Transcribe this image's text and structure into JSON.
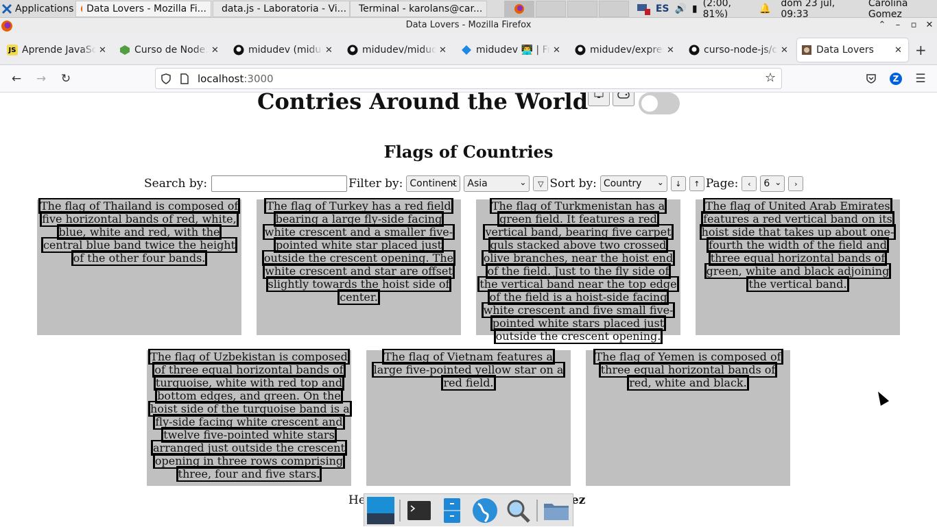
{
  "panel": {
    "applications_label": "Applications",
    "tasks": [
      {
        "label": "Data Lovers - Mozilla Fi..."
      },
      {
        "label": "data.js - Laboratoria - Vi..."
      },
      {
        "label": "Terminal - karolans@car..."
      }
    ],
    "keyboard_layout": "ES",
    "battery": "(2:00, 81%)",
    "datetime": "dom 23 jul, 09:33",
    "user": "Carolina Gomez"
  },
  "window": {
    "title": "Data Lovers - Mozilla Firefox"
  },
  "tabs": [
    {
      "label": "Aprende JavaScript"
    },
    {
      "label": "Curso de Node.js"
    },
    {
      "label": "midudev (midudev)"
    },
    {
      "label": "midudev/midudev"
    },
    {
      "label": "midudev 👨‍💻 | Fro"
    },
    {
      "label": "midudev/express"
    },
    {
      "label": "curso-node-js/cl"
    },
    {
      "label": "Data Lovers"
    }
  ],
  "url": {
    "host": "localhost",
    "port": ":3000"
  },
  "page": {
    "title": "Contries Around the World",
    "subtitle": "Flags of Countries",
    "search_label": "Search by:",
    "search_value": "",
    "filter_label": "Filter by:",
    "filter_field": "Continent",
    "filter_value": "Asia",
    "sort_label": "Sort by:",
    "sort_field": "Country",
    "page_label": "Page:",
    "page_value": "6",
    "footer": "He",
    "footer_bold": "ez"
  },
  "cards": [
    {
      "text": "The flag of Thailand is composed of five horizontal bands of red, white, blue, white and red, with the central blue band twice the height of the other four bands."
    },
    {
      "text": "The flag of Turkey has a red field bearing a large fly-side facing white crescent and a smaller five-pointed white star placed just outside the crescent opening. The white crescent and star are offset slightly towards the hoist side of center."
    },
    {
      "text": "The flag of Turkmenistan has a green field. It features a red vertical band, bearing five carpet guls stacked above two crossed olive branches, near the hoist end of the field. Just to the fly side of the vertical band near the top edge of the field is a hoist-side facing white crescent and five small five-pointed white stars placed just outside the crescent opening."
    },
    {
      "text": "The flag of United Arab Emirates features a red vertical band on its hoist side that takes up about one-fourth the width of the field and three equal horizontal bands of green, white and black adjoining the vertical band."
    },
    {
      "text": "The flag of Uzbekistan is composed of three equal horizontal bands of turquoise, white with red top and bottom edges, and green. On the hoist side of the turquoise band is a fly-side facing white crescent and twelve five-pointed white stars arranged just outside the crescent opening in three rows comprising three, four and five stars."
    },
    {
      "text": "The flag of Vietnam features a large five-pointed yellow star on a red field."
    },
    {
      "text": "The flag of Yemen is composed of three equal horizontal bands of red, white and black."
    }
  ],
  "colors": {
    "card_bg": "#c0c0c0",
    "firefox_accent": "#0060df"
  }
}
